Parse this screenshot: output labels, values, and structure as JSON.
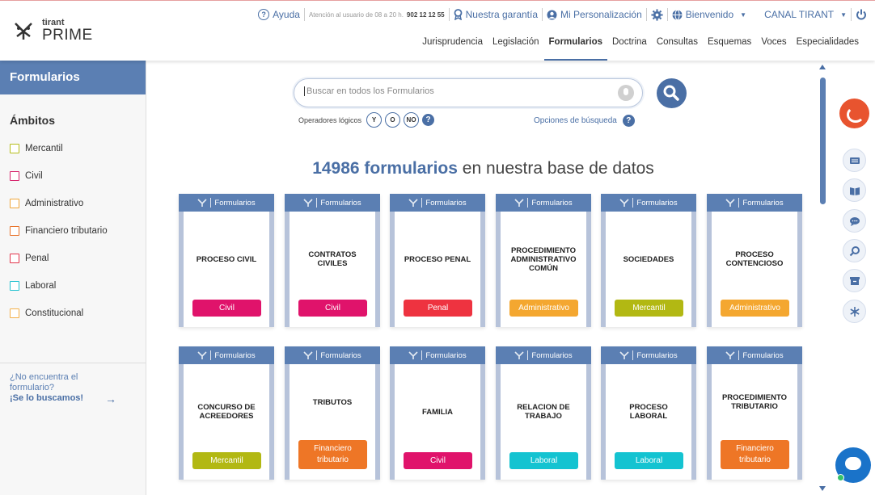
{
  "brand": {
    "top": "tirant",
    "bottom": "PRIME"
  },
  "topbar": {
    "help": "Ayuda",
    "attention": "Atención al usuario de 08 a 20 h.",
    "phone": "902 12 12 55",
    "guarantee": "Nuestra garantía",
    "personalization": "Mi Personalización",
    "welcome": "Bienvenido",
    "channel": "CANAL TIRANT"
  },
  "nav": [
    "Jurisprudencia",
    "Legislación",
    "Formularios",
    "Doctrina",
    "Consultas",
    "Esquemas",
    "Voces",
    "Especialidades"
  ],
  "nav_active": "Formularios",
  "sidebar": {
    "title": "Formularios",
    "heading": "Ámbitos",
    "items": [
      {
        "label": "Mercantil",
        "color": "#b5bd1a"
      },
      {
        "label": "Civil",
        "color": "#d6226b"
      },
      {
        "label": "Administrativo",
        "color": "#f0a63a"
      },
      {
        "label": "Financiero tributario",
        "color": "#e8732a"
      },
      {
        "label": "Penal",
        "color": "#e2334a"
      },
      {
        "label": "Laboral",
        "color": "#1ec0cf"
      },
      {
        "label": "Constitucional",
        "color": "#f4b04a"
      }
    ],
    "footer_q": "¿No encuentra el formulario?",
    "footer_cta": "¡Se lo buscamos!"
  },
  "search": {
    "placeholder": "Buscar en todos los Formularios",
    "operators_label": "Operadores lógicos",
    "operators": [
      "Y",
      "O",
      "NO"
    ],
    "options": "Opciones de búsqueda"
  },
  "headline": {
    "count": "14986 formularios",
    "rest": " en nuestra base de datos"
  },
  "card_header": "Formularios",
  "cards": [
    {
      "title": "PROCESO CIVIL",
      "badge": "Civil",
      "color": "#e0136b"
    },
    {
      "title": "CONTRATOS CIVILES",
      "badge": "Civil",
      "color": "#e0136b"
    },
    {
      "title": "PROCESO PENAL",
      "badge": "Penal",
      "color": "#ee3340"
    },
    {
      "title": "PROCEDIMIENTO ADMINISTRATIVO COMÚN",
      "badge": "Administrativo",
      "color": "#f4a730"
    },
    {
      "title": "SOCIEDADES",
      "badge": "Mercantil",
      "color": "#b2b813"
    },
    {
      "title": "PROCESO CONTENCIOSO",
      "badge": "Administrativo",
      "color": "#f4a730"
    },
    {
      "title": "CONCURSO DE ACREEDORES",
      "badge": "Mercantil",
      "color": "#b2b813"
    },
    {
      "title": "TRIBUTOS",
      "badge": "Financiero tributario",
      "color": "#ee7626"
    },
    {
      "title": "FAMILIA",
      "badge": "Civil",
      "color": "#e0136b"
    },
    {
      "title": "RELACION DE TRABAJO",
      "badge": "Laboral",
      "color": "#14c3d1"
    },
    {
      "title": "PROCESO LABORAL",
      "badge": "Laboral",
      "color": "#14c3d1"
    },
    {
      "title": "PROCEDIMIENTO TRIBUTARIO",
      "badge": "Financiero tributario",
      "color": "#ee7626"
    }
  ],
  "rail_icons": [
    "news-icon",
    "book-icon",
    "chat-bubble-icon",
    "search-icon",
    "archive-icon",
    "network-icon"
  ]
}
